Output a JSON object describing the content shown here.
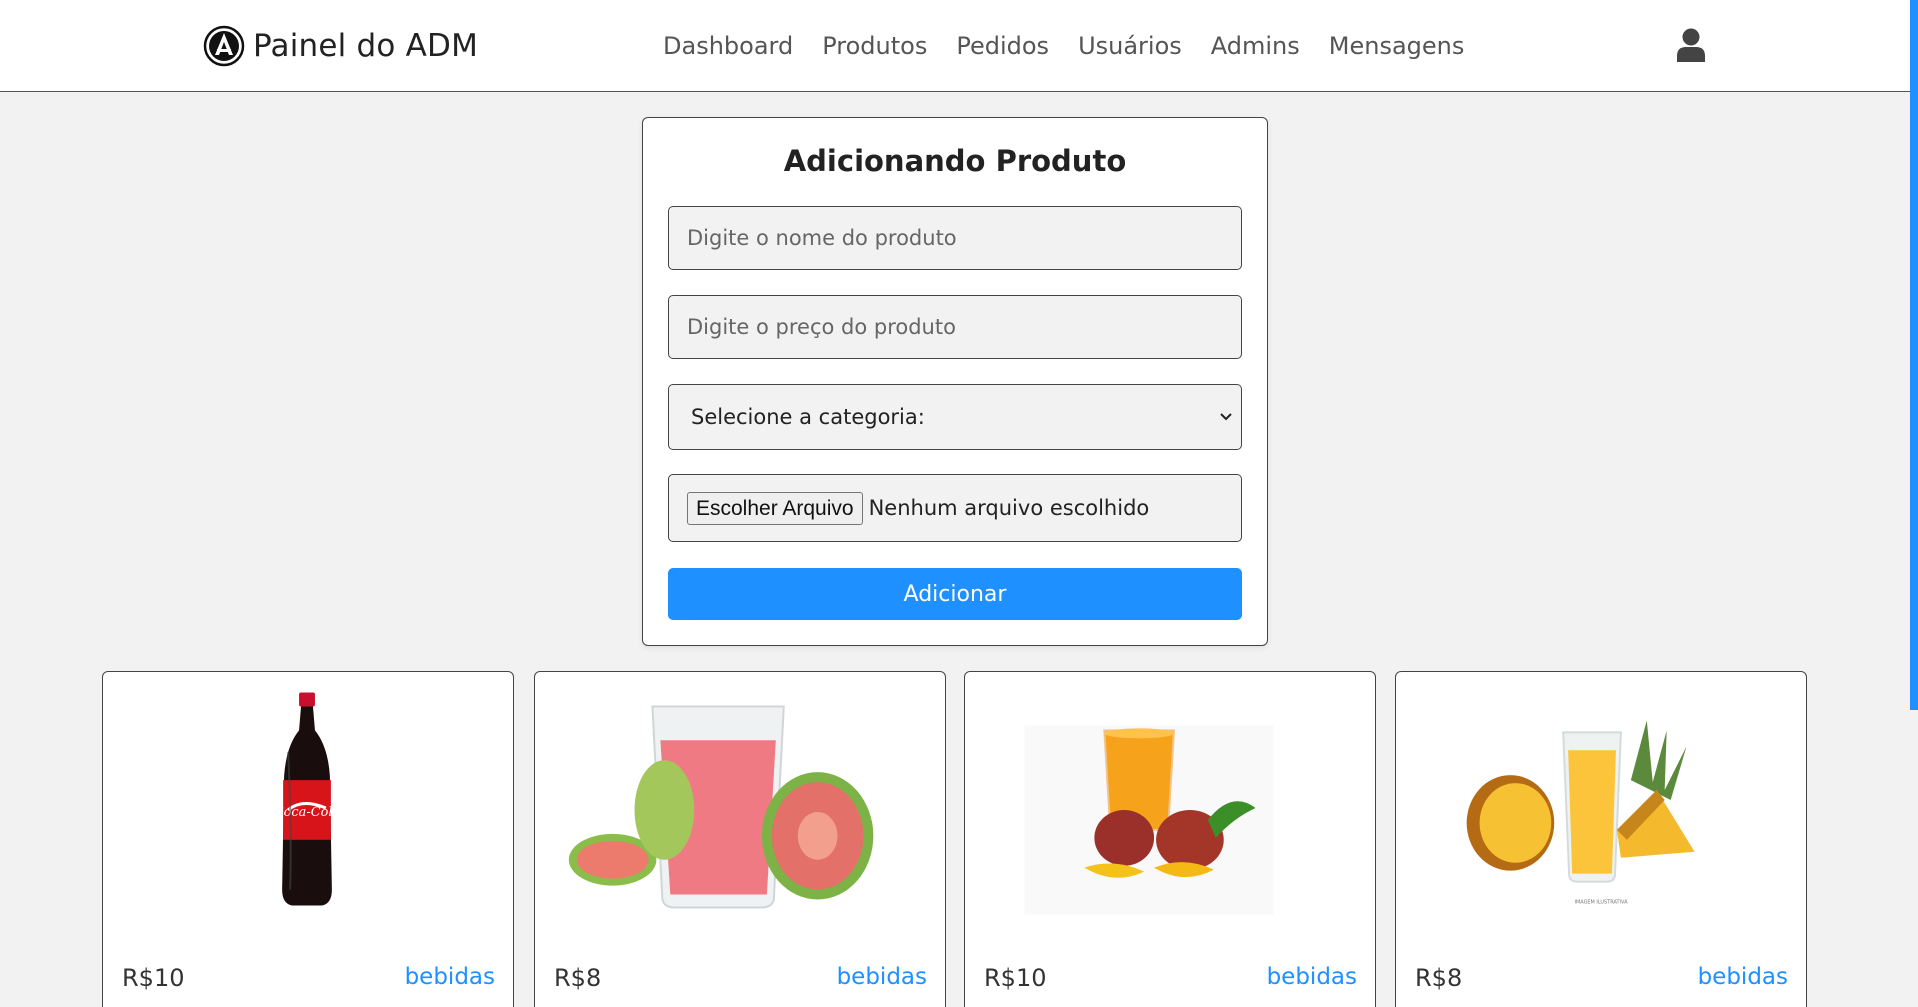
{
  "header": {
    "brand": "Painel do ADM",
    "nav": [
      "Dashboard",
      "Produtos",
      "Pedidos",
      "Usuários",
      "Admins",
      "Mensagens"
    ],
    "user_icon": "user-icon"
  },
  "form": {
    "title": "Adicionando Produto",
    "name_placeholder": "Digite o nome do produto",
    "price_placeholder": "Digite o preço do produto",
    "category_selected": "Selecione a categoria:",
    "file_button": "Escolher Arquivo",
    "file_status": "Nenhum arquivo escolhido",
    "submit": "Adicionar"
  },
  "products": [
    {
      "price": "R$10",
      "category": "bebidas",
      "image": "cola-bottle"
    },
    {
      "price": "R$8",
      "category": "bebidas",
      "image": "guava-juice"
    },
    {
      "price": "R$10",
      "category": "bebidas",
      "image": "mango-juice"
    },
    {
      "price": "R$8",
      "category": "bebidas",
      "image": "pineapple-juice"
    }
  ],
  "colors": {
    "accent": "#1e90ff",
    "background": "#f2f2f2",
    "card": "#ffffff",
    "text": "#222222",
    "nav_text": "#555555"
  }
}
